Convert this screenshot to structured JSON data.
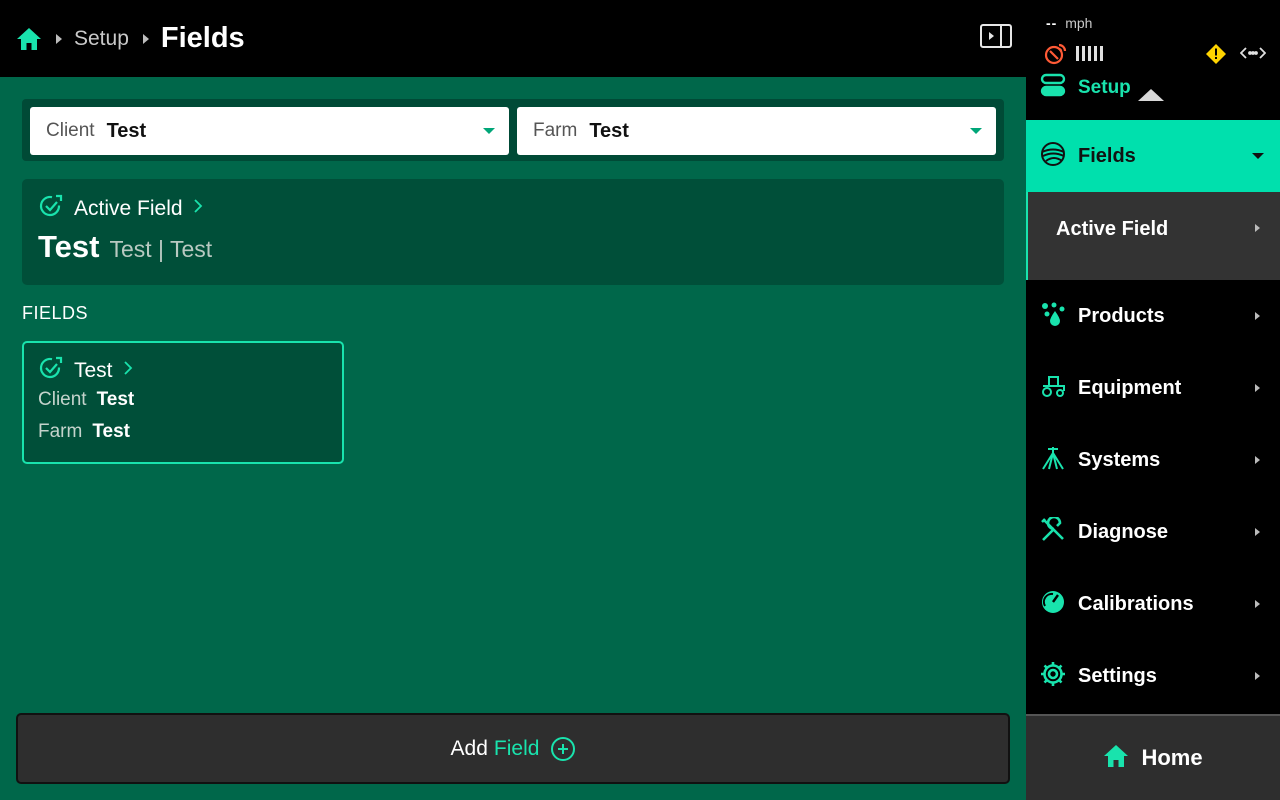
{
  "breadcrumb": {
    "parent": "Setup",
    "current": "Fields"
  },
  "selectors": {
    "client": {
      "label": "Client",
      "value": "Test"
    },
    "farm": {
      "label": "Farm",
      "value": "Test"
    }
  },
  "active_field": {
    "title": "Active Field",
    "name": "Test",
    "subtitle": "Test | Test"
  },
  "fields_section": {
    "label": "FIELDS"
  },
  "fields": [
    {
      "name": "Test",
      "client_label": "Client",
      "client": "Test",
      "farm_label": "Farm",
      "farm": "Test"
    }
  ],
  "add_button": {
    "label_prefix": "Add",
    "label_accent": "Field"
  },
  "status": {
    "speed_value": "--",
    "speed_unit": "mph"
  },
  "sidebar": {
    "setup_label": "Setup",
    "fields_label": "Fields",
    "active_field_label": "Active Field",
    "items": [
      {
        "label": "Products",
        "icon": "products-icon"
      },
      {
        "label": "Equipment",
        "icon": "tractor-icon"
      },
      {
        "label": "Systems",
        "icon": "sprayer-icon"
      },
      {
        "label": "Diagnose",
        "icon": "wrench-screwdriver-icon"
      },
      {
        "label": "Calibrations",
        "icon": "gauge-icon"
      },
      {
        "label": "Settings",
        "icon": "gear-icon"
      }
    ],
    "home_label": "Home"
  },
  "colors": {
    "accent": "#19e3ad",
    "main_bg": "#00674a",
    "card_bg": "#004f39",
    "active_nav": "#00e0ad"
  }
}
